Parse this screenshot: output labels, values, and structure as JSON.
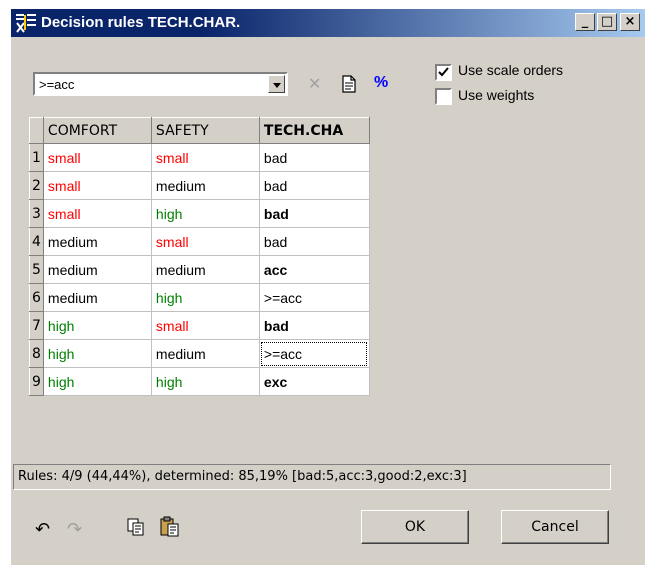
{
  "window": {
    "title": "Decision rules TECH.CHAR."
  },
  "titlebar_buttons": {
    "minimize": "_",
    "maximize": "□",
    "close": "×"
  },
  "toolbar": {
    "combo_value": ">=acc",
    "use_scale_orders": {
      "label": "Use scale orders",
      "checked": true
    },
    "use_weights": {
      "label": "Use weights",
      "checked": false
    }
  },
  "table": {
    "headers": [
      "COMFORT",
      "SAFETY",
      "TECH.CHA"
    ],
    "rows": [
      {
        "num": "1",
        "comfort": "small",
        "safety": "small",
        "tech": "bad"
      },
      {
        "num": "2",
        "comfort": "small",
        "safety": "medium",
        "tech": "bad"
      },
      {
        "num": "3",
        "comfort": "small",
        "safety": "high",
        "tech": "bad"
      },
      {
        "num": "4",
        "comfort": "medium",
        "safety": "small",
        "tech": "bad"
      },
      {
        "num": "5",
        "comfort": "medium",
        "safety": "medium",
        "tech": "acc"
      },
      {
        "num": "6",
        "comfort": "medium",
        "safety": "high",
        "tech": ">=acc"
      },
      {
        "num": "7",
        "comfort": "high",
        "safety": "small",
        "tech": "bad"
      },
      {
        "num": "8",
        "comfort": "high",
        "safety": "medium",
        "tech": ">=acc"
      },
      {
        "num": "9",
        "comfort": "high",
        "safety": "high",
        "tech": "exc"
      }
    ]
  },
  "status": {
    "text": "Rules: 4/9 (44,44%), determined: 85,19% [bad:5,acc:3,good:2,exc:3]"
  },
  "buttons": {
    "ok": "OK",
    "cancel": "Cancel"
  },
  "colors": {
    "low": "#ff0000",
    "mid": "#000000",
    "high": "#008000",
    "titlebar": "#0a246a"
  }
}
